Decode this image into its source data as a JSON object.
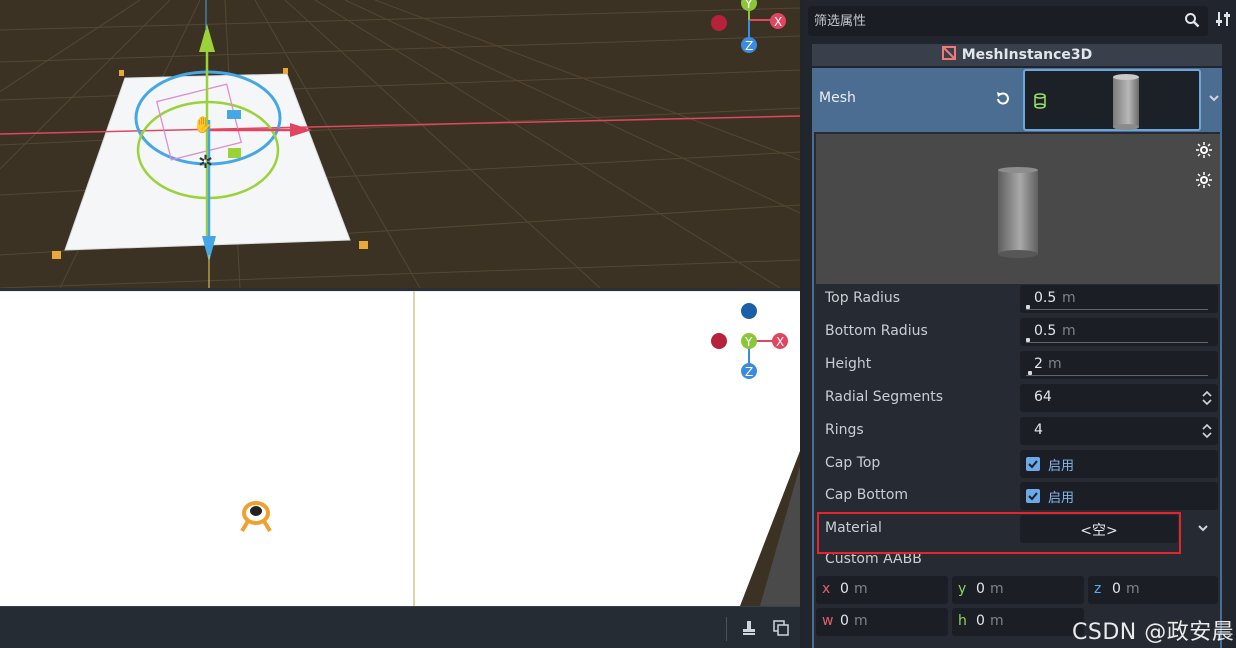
{
  "viewport_top": {
    "gizmo_axes": {
      "x": "X",
      "y": "Y",
      "z": "Z"
    }
  },
  "viewport_bottom": {
    "gizmo_axes": {
      "x": "X",
      "y": "Y",
      "z": "Z"
    }
  },
  "inspector": {
    "filter_placeholder": "筛选属性",
    "section_title": "MeshInstance3D",
    "mesh": {
      "label": "Mesh"
    },
    "properties": [
      {
        "name": "Top Radius",
        "value": "0.5",
        "unit": "m",
        "fraction": 0.0
      },
      {
        "name": "Bottom Radius",
        "value": "0.5",
        "unit": "m",
        "fraction": 0.0
      },
      {
        "name": "Height",
        "value": "2",
        "unit": "m",
        "fraction": 0.01
      },
      {
        "name": "Radial Segments",
        "value": "64"
      },
      {
        "name": "Rings",
        "value": "4"
      }
    ],
    "cap_top": {
      "name": "Cap Top",
      "checked": true,
      "label": "启用"
    },
    "cap_bottom": {
      "name": "Cap Bottom",
      "checked": true,
      "label": "启用"
    },
    "material": {
      "name": "Material",
      "value": "<空>"
    },
    "custom_aabb": {
      "name": "Custom AABB",
      "cells": [
        {
          "axis": "x",
          "value": "0",
          "unit": "m",
          "color": "#e0606a"
        },
        {
          "axis": "y",
          "value": "0",
          "unit": "m",
          "color": "#8bd35c"
        },
        {
          "axis": "z",
          "value": "0",
          "unit": "m",
          "color": "#5aa9ea"
        },
        {
          "axis": "w",
          "value": "0",
          "unit": "m",
          "color": "#e0606a"
        },
        {
          "axis": "h",
          "value": "0",
          "unit": "m",
          "color": "#8bd35c"
        }
      ]
    }
  },
  "watermark": "CSDN @政安晨",
  "colors": {
    "accent": "#4b6d92",
    "highlight": "#e5242b",
    "checkbox": "#6da8e8"
  }
}
